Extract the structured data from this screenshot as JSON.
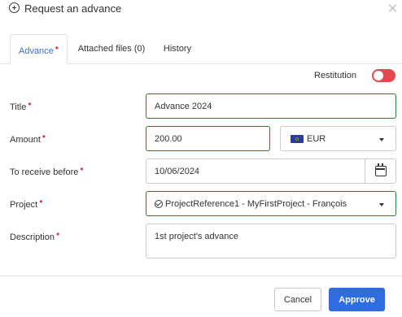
{
  "dialog": {
    "title": "Request an advance",
    "tabs": [
      {
        "label": "Advance",
        "required": "•"
      },
      {
        "label": "Attached files (0)"
      },
      {
        "label": "History"
      }
    ],
    "restitution": {
      "label": "Restitution",
      "enabled": false
    },
    "fields": {
      "title": {
        "label": "Title",
        "required": "•",
        "value": "Advance 2024"
      },
      "amount": {
        "label": "Amount",
        "required": "•",
        "value": "200.00",
        "currency": "EUR"
      },
      "receive_before": {
        "label": "To receive before",
        "required": "•",
        "value": "10/06/2024"
      },
      "project": {
        "label": "Project",
        "required": "•",
        "value": "ProjectReference1 - MyFirstProject - François"
      },
      "description": {
        "label": "Description",
        "required": "•",
        "value": "1st project's advance"
      }
    },
    "buttons": {
      "cancel": "Cancel",
      "approve": "Approve"
    }
  },
  "colors": {
    "accent": "#2f6ce0",
    "valid_border": "#2e7d32",
    "required": "#d9364f",
    "toggle_off": "#e5474f"
  }
}
